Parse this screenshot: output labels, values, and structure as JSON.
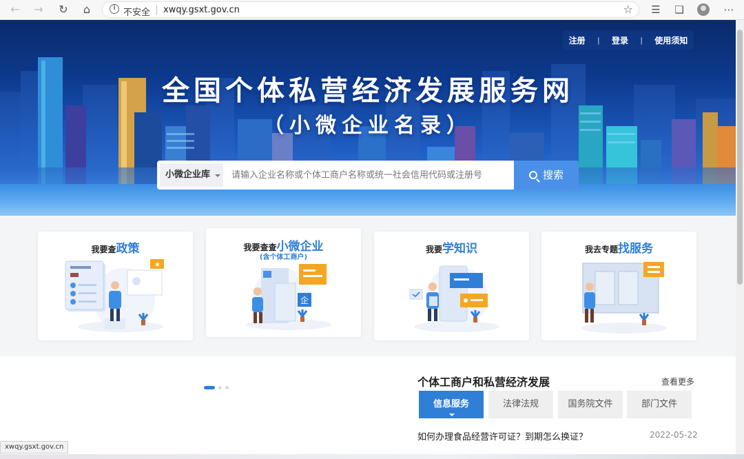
{
  "browser": {
    "security_label": "不安全",
    "url": "xwqy.gsxt.gov.cn",
    "status_url": "xwqy.gsxt.gov.cn"
  },
  "header": {
    "links": [
      "注册",
      "登录",
      "使用须知"
    ],
    "title": "全国个体私营经济发展服务网",
    "subtitle": "（小微企业名录）"
  },
  "search": {
    "scope": "小微企业库",
    "placeholder": "请输入企业名称或个体工商户名称或统一社会信用代码或注册号",
    "button": "搜索"
  },
  "cards": [
    {
      "prefix": "我要查",
      "emphasis": "政策",
      "sub": ""
    },
    {
      "prefix": "我要查查",
      "emphasis": "小微企业",
      "sub": "(含个体工商户)"
    },
    {
      "prefix": "我要",
      "emphasis": "学知识",
      "sub": ""
    },
    {
      "prefix": "我去专题",
      "emphasis": "找服务",
      "sub": ""
    }
  ],
  "section": {
    "title": "个体工商户和私营经济发展",
    "more": "查看更多",
    "tabs": [
      "信息服务",
      "法律法规",
      "国务院文件",
      "部门文件"
    ],
    "news": [
      {
        "title": "如何办理食品经营许可证？到期怎么换证？",
        "date": "2022-05-22"
      }
    ]
  },
  "colors": {
    "accent": "#2f7fd6",
    "search_button": "#4a90e8",
    "banner_top": "#0a2a6b"
  }
}
